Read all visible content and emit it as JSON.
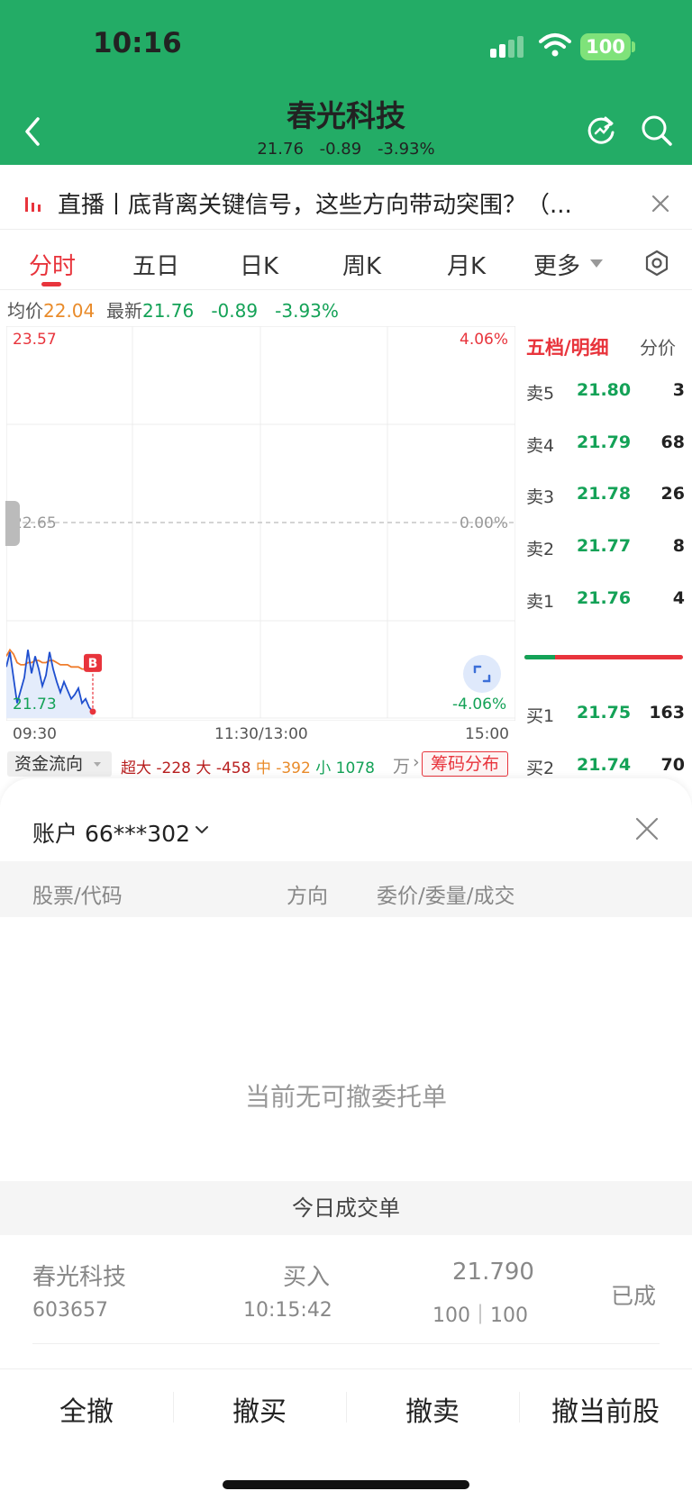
{
  "status": {
    "time": "10:16",
    "battery": "100"
  },
  "header": {
    "title": "春光科技",
    "price": "21.76",
    "change": "-0.89",
    "change_pct": "-3.93%"
  },
  "news": {
    "text": "直播丨底背离关键信号，这些方向带动突围？（..."
  },
  "tabs": [
    "分时",
    "五日",
    "日K",
    "周K",
    "月K",
    "更多"
  ],
  "price_row": {
    "avg_label": "均价",
    "avg_value": "22.04",
    "latest_label": "最新",
    "latest_value": "21.76",
    "change": "-0.89",
    "change_pct": "-3.93%"
  },
  "chart": {
    "y_top": "23.57",
    "y_mid": "22.65",
    "y_bottom": "21.73",
    "pct_top": "4.06%",
    "pct_mid": "0.00%",
    "pct_bottom": "-4.06%",
    "x_start": "09:30",
    "x_mid": "11:30/13:00",
    "x_end": "15:00",
    "marker": "B",
    "colors": {
      "price": "#1f4fcf",
      "avg": "#ef7d2d",
      "down": "#14a257",
      "up": "#e8343c"
    }
  },
  "chart_data": {
    "type": "line",
    "ylim": [
      21.73,
      23.57
    ],
    "series": [
      {
        "values": [
          21.97,
          22.04,
          21.92,
          21.8,
          21.86,
          21.92,
          22.05,
          21.94,
          22.02,
          21.96,
          21.88,
          21.93,
          22.04,
          21.96,
          21.9,
          21.85,
          21.9,
          21.86,
          21.82,
          21.84,
          21.87,
          21.8,
          21.82,
          21.78,
          21.76
        ]
      },
      {
        "values": [
          22.02,
          22.05,
          22.03,
          21.99,
          21.98,
          21.98,
          21.99,
          21.99,
          22.0,
          22.0,
          21.99,
          21.99,
          22.0,
          22.0,
          21.99,
          21.98,
          21.98,
          21.98,
          21.97,
          21.97,
          21.97,
          21.96,
          21.96,
          21.95,
          21.95
        ]
      }
    ]
  },
  "fund_flow": {
    "label": "资金流向",
    "super_label": "超大",
    "super_value": "-228",
    "big_label": "大",
    "big_value": "-458",
    "mid_label": "中",
    "mid_value": "-392",
    "small_label": "小",
    "small_value": "1078",
    "unit": "万",
    "chip_label": "筹码分布"
  },
  "orderbook": {
    "header_left": "五档/明细",
    "header_right": "分价",
    "sells": [
      {
        "label": "卖5",
        "price": "21.80",
        "vol": "3"
      },
      {
        "label": "卖4",
        "price": "21.79",
        "vol": "68"
      },
      {
        "label": "卖3",
        "price": "21.78",
        "vol": "26"
      },
      {
        "label": "卖2",
        "price": "21.77",
        "vol": "8"
      },
      {
        "label": "卖1",
        "price": "21.76",
        "vol": "4"
      }
    ],
    "buys": [
      {
        "label": "买1",
        "price": "21.75",
        "vol": "163"
      },
      {
        "label": "买2",
        "price": "21.74",
        "vol": "70"
      }
    ]
  },
  "sheet": {
    "account": "账户 66***302",
    "columns": [
      "股票/代码",
      "方向",
      "委价/委量/成交"
    ],
    "empty": "当前无可撤委托单",
    "today_header": "今日成交单",
    "trade": {
      "name": "春光科技",
      "code": "603657",
      "direction": "买入",
      "time": "10:15:42",
      "price": "21.790",
      "qty": "100｜100",
      "status": "已成"
    },
    "actions": [
      "全撤",
      "撤买",
      "撤卖",
      "撤当前股"
    ]
  }
}
